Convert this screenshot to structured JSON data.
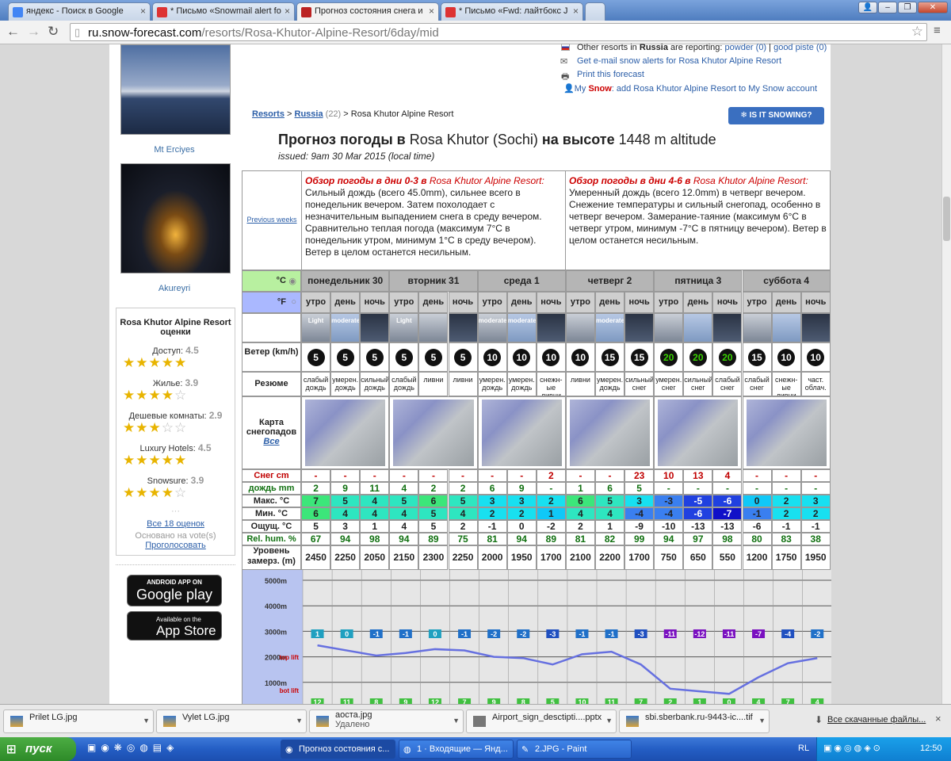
{
  "browser": {
    "tabs": [
      {
        "label": "яндекс - Поиск в Google",
        "color": "#4285f4",
        "glyph": "8"
      },
      {
        "label": "* Письмо «Snowmail alert fo",
        "color": "#d33",
        "glyph": "Я"
      },
      {
        "label": "Прогноз состояния снега и",
        "color": "#b22",
        "glyph": "❄"
      },
      {
        "label": "* Письмо «Fwd: лайтбокс J",
        "color": "#d33",
        "glyph": "Я"
      }
    ],
    "url_host": "ru.snow-forecast.com",
    "url_path": "/resorts/Rosa-Khutor-Alpine-Resort/6day/mid"
  },
  "sidebar": {
    "photo1_caption": "Mt Erciyes",
    "photo2_caption": "Akureyri",
    "ratings_title": "Rosa Khutor Alpine Resort оценки",
    "ratings": [
      {
        "label": "Доступ:",
        "value": "4.5",
        "stars": 4.5
      },
      {
        "label": "Жилье:",
        "value": "3.9",
        "stars": 4
      },
      {
        "label": "Дешевые комнаты:",
        "value": "2.9",
        "stars": 3
      },
      {
        "label": "Luxury Hotels:",
        "value": "4.5",
        "stars": 4.5
      },
      {
        "label": "Snowsure:",
        "value": "3.9",
        "stars": 4
      }
    ],
    "all_ratings": "Все 18 оценок",
    "based_on": "Основано на vote(s)",
    "vote": "Проголосовать",
    "android_small": "ANDROID APP ON",
    "android_big": "Google play",
    "apple_small": "Available on the",
    "apple_big": "App Store"
  },
  "toplinks": {
    "other_resorts_prefix": "Other resorts in",
    "country": "Russia",
    "reporting": "are reporting:",
    "powder": "powder (0)",
    "good_piste": "good piste (0)",
    "email_alert": "Get e-mail snow alerts for Rosa Khutor Alpine Resort",
    "print": "Print this forecast",
    "mysnow_prefix": "My",
    "mysnow_brand": "Snow",
    "mysnow_text": ": add Rosa Khutor Alpine Resort to My Snow account"
  },
  "breadcrumb": {
    "resorts": "Resorts",
    "russia": "Russia",
    "count": "(22)",
    "current": "> Rosa Khutor Alpine Resort"
  },
  "is_snowing": "❄ IS IT SNOWING?",
  "title_bold1": "Прогноз погоды в",
  "title_place": "Rosa Khutor (Sochi)",
  "title_bold2": "на высоте",
  "title_alt": "1448 m altitude",
  "issued": "issued: 9am 30 Mar 2015 (local time)",
  "summary": {
    "prev_weeks": "Previous weeks",
    "left_head": "Обзор погоды в дни 0-3 в",
    "left_resort": "Rosa Khutor Alpine Resort:",
    "left_text": "Сильный дождь (всего 45.0mm), сильнее всего в понедельник вечером. Затем похолодает с незначительным выпадением снега в среду вечером. Сравнительно теплая погода (максимум 7°C в понедельник утром, минимум 1°C в среду вечером). Ветер в целом останется несильным.",
    "right_head": "Обзор погоды в дни 4-6 в",
    "right_resort": "Rosa Khutor Alpine Resort:",
    "right_text": "Умеренный дождь (всего 12.0mm) в четверг вечером. Снежение температуры и сильный снегопад, особенно в четверг вечером. Замерание-таяние (максимум 6°C в четверг утром, минимум -7°C в пятницу вечером). Ветер в целом останется несильным."
  },
  "units": {
    "c": "°C",
    "f": "°F"
  },
  "days": [
    "понедельник 30",
    "вторник 31",
    "среда 1",
    "четверг 2",
    "пятница 3",
    "суббота 4"
  ],
  "periods": [
    "утро",
    "день",
    "ночь"
  ],
  "icons": [
    "Light",
    "moderate",
    "",
    "Light",
    "",
    "",
    "moderate",
    "moderate",
    "",
    "",
    "moderate",
    "",
    "",
    "",
    "",
    "",
    "",
    ""
  ],
  "labels": {
    "wind": "Ветер (km/h)",
    "summary": "Резюме",
    "map": "Карта снегопадов",
    "map_all": "Все",
    "snow": "Снег cm",
    "rain": "дождь mm",
    "max": "Макс. °C",
    "min": "Мин. °C",
    "feel": "Ощущ. °C",
    "hum": "Rel. hum. %",
    "freeze": "Уровень замерз. (m)"
  },
  "wind": [
    "5",
    "5",
    "5",
    "5",
    "5",
    "5",
    "10",
    "10",
    "10",
    "10",
    "15",
    "15",
    "20",
    "20",
    "20",
    "15",
    "10",
    "10"
  ],
  "summaries": [
    "слабый дождь",
    "умерен. дождь",
    "сильный дождь",
    "слабый дождь",
    "ливни",
    "ливни",
    "умерен. дождь",
    "умерен. дождь",
    "снежн-ые ливни",
    "ливни",
    "умерен. дождь",
    "сильный снег",
    "умерен. снег",
    "сильный снег",
    "слабый снег",
    "слабый снег",
    "снежн-ые ливни",
    "част. облач."
  ],
  "snow": [
    "-",
    "-",
    "-",
    "-",
    "-",
    "-",
    "-",
    "-",
    "2",
    "-",
    "-",
    "23",
    "10",
    "13",
    "4",
    "-",
    "-",
    "-"
  ],
  "rain": [
    "2",
    "9",
    "11",
    "4",
    "2",
    "2",
    "6",
    "9",
    "-",
    "1",
    "6",
    "5",
    "-",
    "-",
    "-",
    "-",
    "-",
    "-"
  ],
  "max": [
    "7",
    "5",
    "4",
    "5",
    "6",
    "5",
    "3",
    "3",
    "2",
    "6",
    "5",
    "3",
    "-3",
    "-5",
    "-6",
    "0",
    "2",
    "3"
  ],
  "min": [
    "6",
    "4",
    "4",
    "4",
    "5",
    "4",
    "2",
    "2",
    "1",
    "4",
    "4",
    "-4",
    "-4",
    "-6",
    "-7",
    "-1",
    "2",
    "2"
  ],
  "feel": [
    "5",
    "3",
    "1",
    "4",
    "5",
    "2",
    "-1",
    "0",
    "-2",
    "2",
    "1",
    "-9",
    "-10",
    "-13",
    "-13",
    "-6",
    "-1",
    "-1"
  ],
  "hum": [
    "67",
    "94",
    "98",
    "94",
    "89",
    "75",
    "81",
    "94",
    "89",
    "81",
    "82",
    "99",
    "94",
    "97",
    "98",
    "80",
    "83",
    "38"
  ],
  "freeze": [
    "2450",
    "2250",
    "2050",
    "2150",
    "2300",
    "2250",
    "2000",
    "1950",
    "1700",
    "2100",
    "2200",
    "1700",
    "750",
    "650",
    "550",
    "1200",
    "1750",
    "1950"
  ],
  "chart": {
    "y_labels": [
      "5000m",
      "4000m",
      "3000m",
      "2000m",
      "1000m"
    ],
    "top_lift": "top lift",
    "bot_lift": "bot lift",
    "temp_labels": [
      "1",
      "0",
      "-1",
      "-1",
      "0",
      "-1",
      "-2",
      "-2",
      "-3",
      "-1",
      "-1",
      "-3",
      "-11",
      "-12",
      "-11",
      "-7",
      "-4",
      "-2"
    ],
    "bottom_labels": [
      "12",
      "11",
      "8",
      "9",
      "12",
      "7",
      "9",
      "8",
      "5",
      "10",
      "11",
      "7",
      "2",
      "1",
      "0",
      "4",
      "7",
      "4"
    ]
  },
  "downloads": [
    {
      "name": "Prilet LG.jpg",
      "sub": ""
    },
    {
      "name": "Vylet LG.jpg",
      "sub": ""
    },
    {
      "name": "аоста.jpg",
      "sub": "Удалено"
    },
    {
      "name": "Airport_sign_desctipti....pptx",
      "sub": ""
    },
    {
      "name": "sbi.sberbank.ru-9443-ic....tif",
      "sub": ""
    }
  ],
  "all_downloads": "Все скачанные файлы...",
  "taskbar": {
    "start": "пуск",
    "items": [
      "Прогноз состояния с...",
      "1 · Входящие — Янд...",
      "2.JPG - Paint"
    ],
    "lang": "RL",
    "clock": "12:50"
  }
}
